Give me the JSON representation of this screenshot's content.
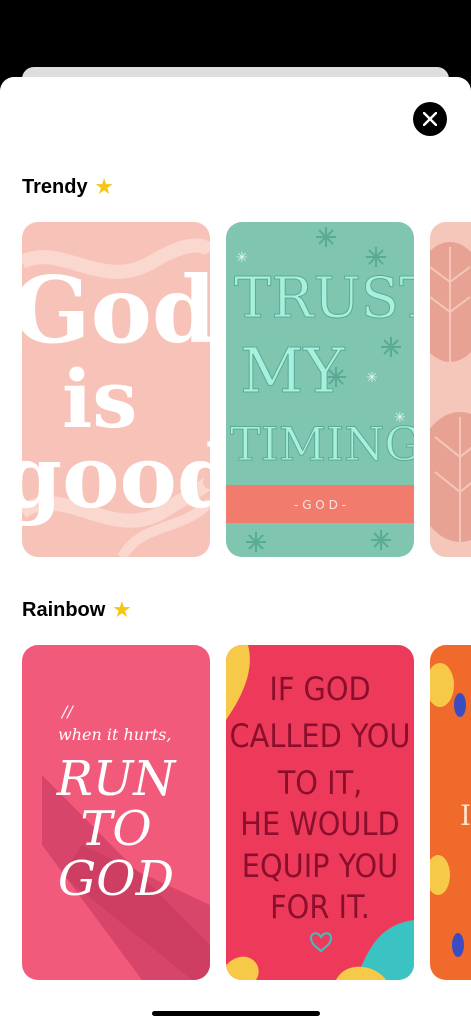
{
  "sheet": {
    "close_icon": "close-icon"
  },
  "sections": [
    {
      "title": "Trendy",
      "icon": "star-icon",
      "cards": [
        {
          "lines": [
            "God",
            "is",
            "good"
          ]
        },
        {
          "lines": [
            "TRUST",
            "MY",
            "TIMING."
          ],
          "attribution": "- G O D -"
        },
        {
          "lines": []
        }
      ]
    },
    {
      "title": "Rainbow",
      "icon": "star-icon",
      "cards": [
        {
          "lines": [
            "when it hurts,",
            "RUN",
            "TO",
            "GOD"
          ],
          "mark": "//"
        },
        {
          "lines": [
            "IF GOD",
            "CALLED YOU",
            "TO IT,",
            "HE WOULD",
            "EQUIP YOU",
            "FOR IT."
          ]
        },
        {
          "lines": [
            "I"
          ]
        }
      ]
    }
  ],
  "colors": {
    "accent_star": "#f5c518",
    "trendy_pink": "#f7c3b8",
    "trendy_teal": "#7fc5b0",
    "rainbow_pink": "#f25a7c",
    "rainbow_red": "#ee3a5a",
    "rainbow_orange": "#f06a2b"
  }
}
